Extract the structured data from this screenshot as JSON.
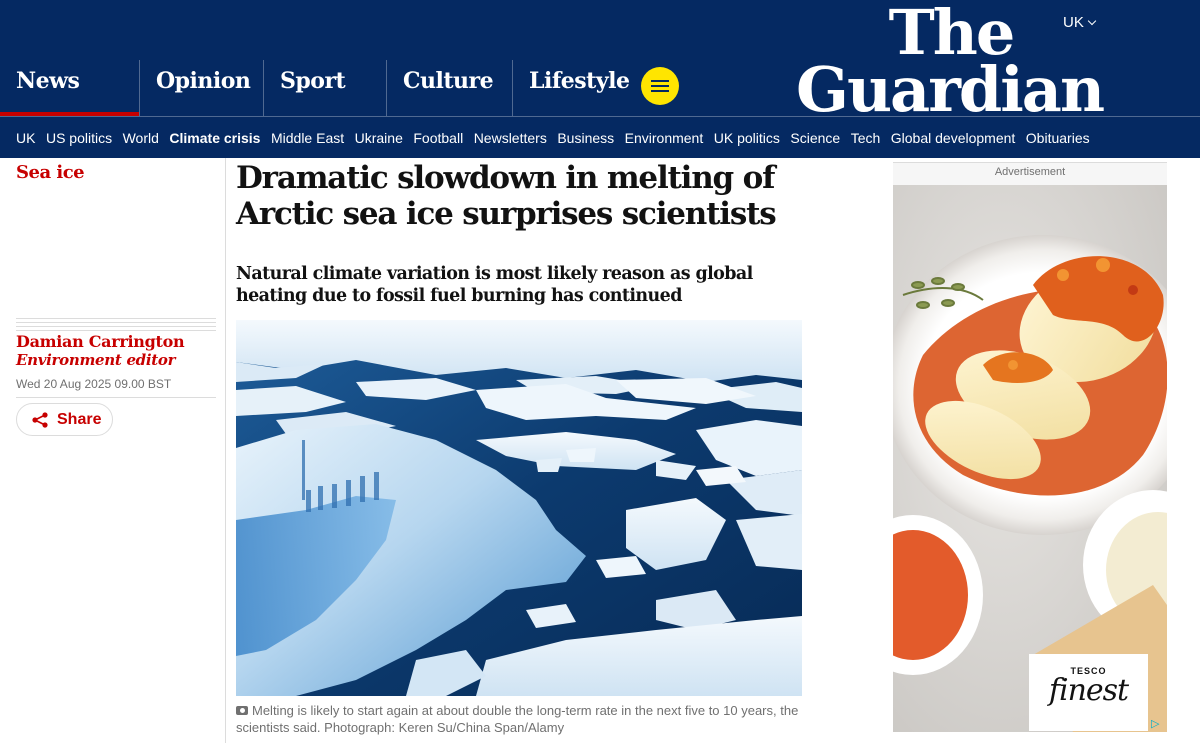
{
  "header": {
    "edition": "UK",
    "logo": {
      "line1": "The",
      "line2": "Guardian"
    },
    "pillars": [
      {
        "label": "News",
        "active": true
      },
      {
        "label": "Opinion"
      },
      {
        "label": "Sport"
      },
      {
        "label": "Culture"
      },
      {
        "label": "Lifestyle"
      }
    ],
    "menu_icon": "hamburger-icon",
    "subnav": [
      "UK",
      "US politics",
      "World",
      "Climate crisis",
      "Middle East",
      "Ukraine",
      "Football",
      "Newsletters",
      "Business",
      "Environment",
      "UK politics",
      "Science",
      "Tech",
      "Global development",
      "Obituaries"
    ],
    "subnav_bold": "Climate crisis"
  },
  "article": {
    "section": "Sea ice",
    "headline": "Dramatic slowdown in melting of Arctic sea ice surprises scientists",
    "standfirst": "Natural climate variation is most likely reason as global heating due to fossil fuel burning has continued",
    "author": "Damian Carrington",
    "role": "Environment editor",
    "date": "Wed 20 Aug 2025 09.00 BST",
    "share_label": "Share",
    "caption": "Melting is likely to start again at about double the long-term rate in the next five to 10 years, the scientists said. Photograph: Keren Su/China Span/Alamy"
  },
  "ad": {
    "label": "Advertisement",
    "brand_top": "TESCO",
    "brand_main": "finest"
  },
  "colors": {
    "brand_blue": "#052962",
    "news_red": "#c70000",
    "menu_yellow": "#ffe500"
  }
}
